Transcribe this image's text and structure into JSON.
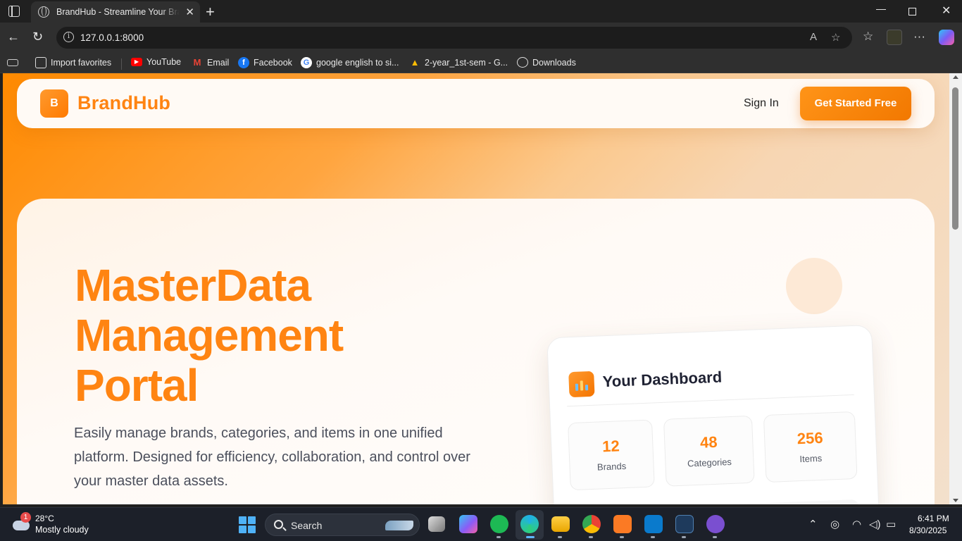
{
  "browser": {
    "tab_title": "BrandHub - Streamline Your Brand",
    "url": "127.0.0.1:8000",
    "favorites": [
      {
        "label": "Import favorites",
        "icon": "import-icon"
      },
      {
        "label": "YouTube",
        "icon": "youtube-icon",
        "color": "#ff0000"
      },
      {
        "label": "Email",
        "icon": "gmail-icon",
        "color": "#ea4335"
      },
      {
        "label": "Facebook",
        "icon": "facebook-icon",
        "color": "#1877f2"
      },
      {
        "label": "google english to si...",
        "icon": "google-icon"
      },
      {
        "label": "2-year_1st-sem - G...",
        "icon": "google-drive-icon"
      },
      {
        "label": "Downloads",
        "icon": "globe-icon"
      }
    ]
  },
  "site": {
    "logo_letter": "B",
    "brand": "BrandHub",
    "nav": {
      "signin": "Sign In",
      "cta": "Get Started Free"
    },
    "hero": {
      "title_lines": [
        "MasterData",
        "Management",
        "Portal"
      ],
      "description": "Easily manage brands, categories, and items in one unified platform. Designed for efficiency, collaboration, and control over your master data assets."
    },
    "dashboard": {
      "title": "Your Dashboard",
      "stats": [
        {
          "value": "12",
          "label": "Brands"
        },
        {
          "value": "48",
          "label": "Categories"
        },
        {
          "value": "256",
          "label": "Items"
        }
      ]
    },
    "accent_color": "#ff8412"
  },
  "taskbar": {
    "weather": {
      "badge": "1",
      "temp": "28°C",
      "desc": "Mostly cloudy"
    },
    "search_placeholder": "Search",
    "clock": {
      "time": "6:41 PM",
      "date": "8/30/2025"
    }
  }
}
